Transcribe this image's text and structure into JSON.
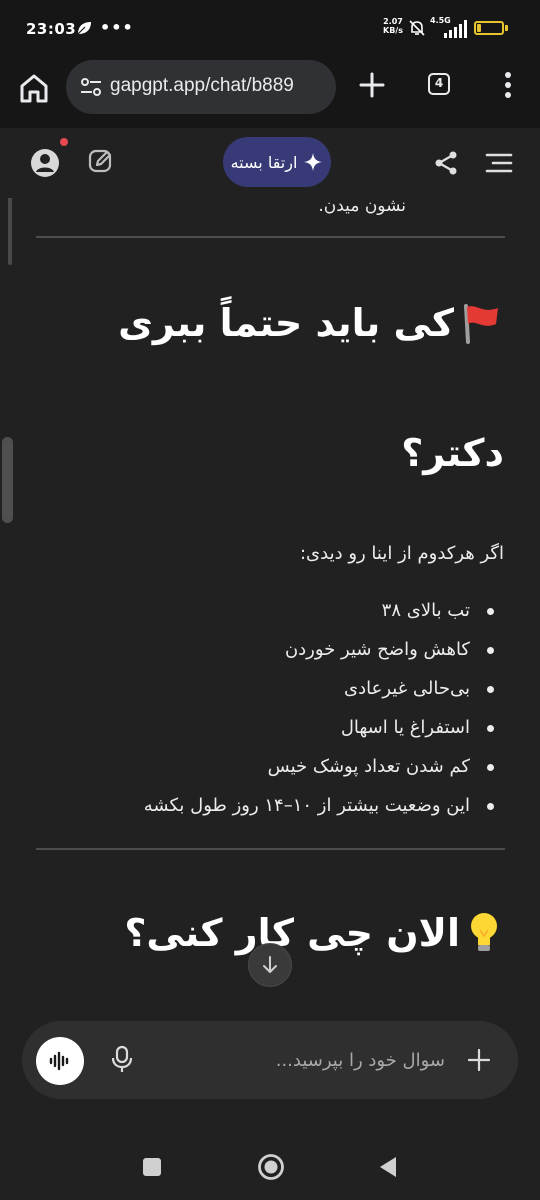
{
  "status_bar": {
    "time": "23:03",
    "more": "•••",
    "net_speed_value": "2.07",
    "net_speed_unit": "KB/s",
    "network": "4.5G",
    "battery": "17"
  },
  "browser": {
    "url": "gapgpt.app/chat/b889",
    "tab_count": "4"
  },
  "header": {
    "upgrade_label": "ارتقا بسته"
  },
  "content": {
    "previous_line": "نشون میدن.",
    "heading_1": "کی باید حتماً ببری",
    "heading_1_cont": "دکتر؟",
    "intro": "اگر هرکدوم از اینا رو دیدی:",
    "list": [
      "تب بالای ۳۸",
      "کاهش واضح شیر خوردن",
      "بی‌حالی غیرعادی",
      "استفراغ یا اسهال",
      "کم شدن تعداد پوشک خیس",
      "این وضعیت بیشتر از ۱۰–۱۴ روز طول بکشه"
    ],
    "heading_2": "الان چی کار کنی؟"
  },
  "composer": {
    "placeholder": "سوال خود را بپرسید..."
  },
  "colors": {
    "background": "#212121",
    "upgrade_button": "#373a76",
    "battery": "#e8c330",
    "notification_dot": "#e5484d"
  },
  "icons": [
    "leaf-icon",
    "mute-bell-icon",
    "signal-icon",
    "battery-icon",
    "home-icon",
    "tune-icon",
    "plus-icon",
    "tabs-icon",
    "kebab-menu-icon",
    "account-icon",
    "edit-icon",
    "sparkle-icon",
    "share-icon",
    "hamburger-icon",
    "flag-icon",
    "lightbulb-icon",
    "arrow-down-icon",
    "voice-waveform-icon",
    "mic-icon",
    "plus-icon",
    "recent-apps-icon",
    "home-circle-icon",
    "back-triangle-icon"
  ]
}
